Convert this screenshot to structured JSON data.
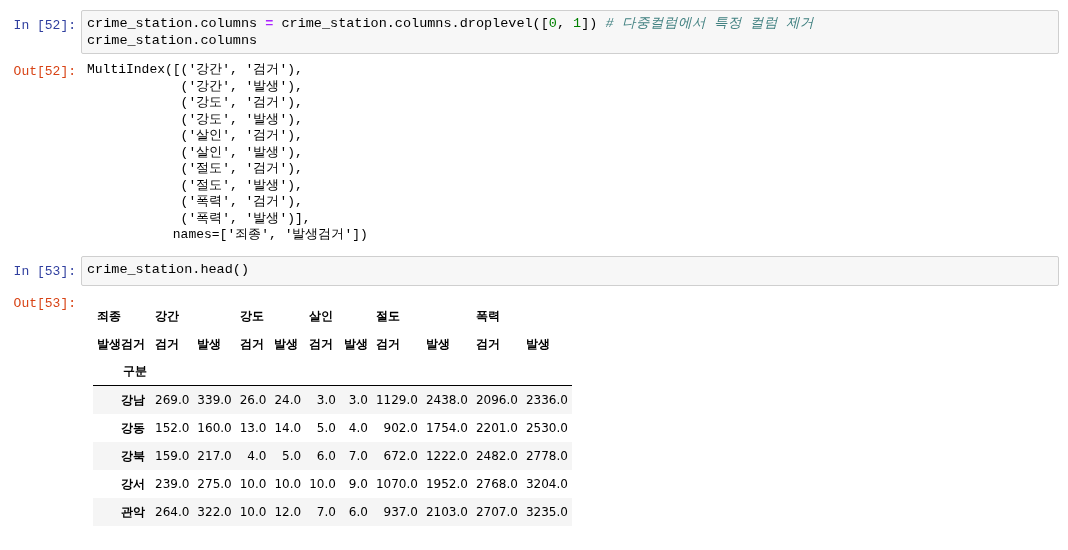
{
  "cells": [
    {
      "kind": "code",
      "prompt": "In [52]:",
      "code_lines": [
        [
          {
            "kind": "text",
            "text": "crime_station.columns "
          },
          {
            "kind": "operator",
            "text": "="
          },
          {
            "kind": "text",
            "text": " crime_station.columns.droplevel(["
          },
          {
            "kind": "number",
            "text": "0"
          },
          {
            "kind": "text",
            "text": ", "
          },
          {
            "kind": "number",
            "text": "1"
          },
          {
            "kind": "text",
            "text": "]) "
          },
          {
            "kind": "comment",
            "text": "# 다중컬럼에서 특정 컬럼 제거"
          }
        ],
        [
          {
            "kind": "text",
            "text": "crime_station.columns"
          }
        ]
      ],
      "output": {
        "kind": "text",
        "prompt": "Out[52]:",
        "lines": [
          "MultiIndex([('강간', '검거'),",
          "            ('강간', '발생'),",
          "            ('강도', '검거'),",
          "            ('강도', '발생'),",
          "            ('살인', '검거'),",
          "            ('살인', '발생'),",
          "            ('절도', '검거'),",
          "            ('절도', '발생'),",
          "            ('폭력', '검거'),",
          "            ('폭력', '발생')],",
          "           names=['죄종', '발생검거'])"
        ]
      }
    },
    {
      "kind": "code",
      "prompt": "In [53]:",
      "code_lines": [
        [
          {
            "kind": "text",
            "text": "crime_station.head()"
          }
        ]
      ],
      "output": {
        "kind": "table",
        "prompt": "Out[53]:",
        "level0_name": "죄종",
        "level1_name": "발생검거",
        "index_name": "구분",
        "column_groups": [
          {
            "label": "강간",
            "columns": [
              "검거",
              "발생"
            ]
          },
          {
            "label": "강도",
            "columns": [
              "검거",
              "발생"
            ]
          },
          {
            "label": "살인",
            "columns": [
              "검거",
              "발생"
            ]
          },
          {
            "label": "절도",
            "columns": [
              "검거",
              "발생"
            ]
          },
          {
            "label": "폭력",
            "columns": [
              "검거",
              "발생"
            ]
          }
        ],
        "rows": [
          {
            "index": "강남",
            "values": [
              "269.0",
              "339.0",
              "26.0",
              "24.0",
              "3.0",
              "3.0",
              "1129.0",
              "2438.0",
              "2096.0",
              "2336.0"
            ]
          },
          {
            "index": "강동",
            "values": [
              "152.0",
              "160.0",
              "13.0",
              "14.0",
              "5.0",
              "4.0",
              "902.0",
              "1754.0",
              "2201.0",
              "2530.0"
            ]
          },
          {
            "index": "강북",
            "values": [
              "159.0",
              "217.0",
              "4.0",
              "5.0",
              "6.0",
              "7.0",
              "672.0",
              "1222.0",
              "2482.0",
              "2778.0"
            ]
          },
          {
            "index": "강서",
            "values": [
              "239.0",
              "275.0",
              "10.0",
              "10.0",
              "10.0",
              "9.0",
              "1070.0",
              "1952.0",
              "2768.0",
              "3204.0"
            ]
          },
          {
            "index": "관악",
            "values": [
              "264.0",
              "322.0",
              "10.0",
              "12.0",
              "7.0",
              "6.0",
              "937.0",
              "2103.0",
              "2707.0",
              "3235.0"
            ]
          }
        ]
      }
    }
  ]
}
